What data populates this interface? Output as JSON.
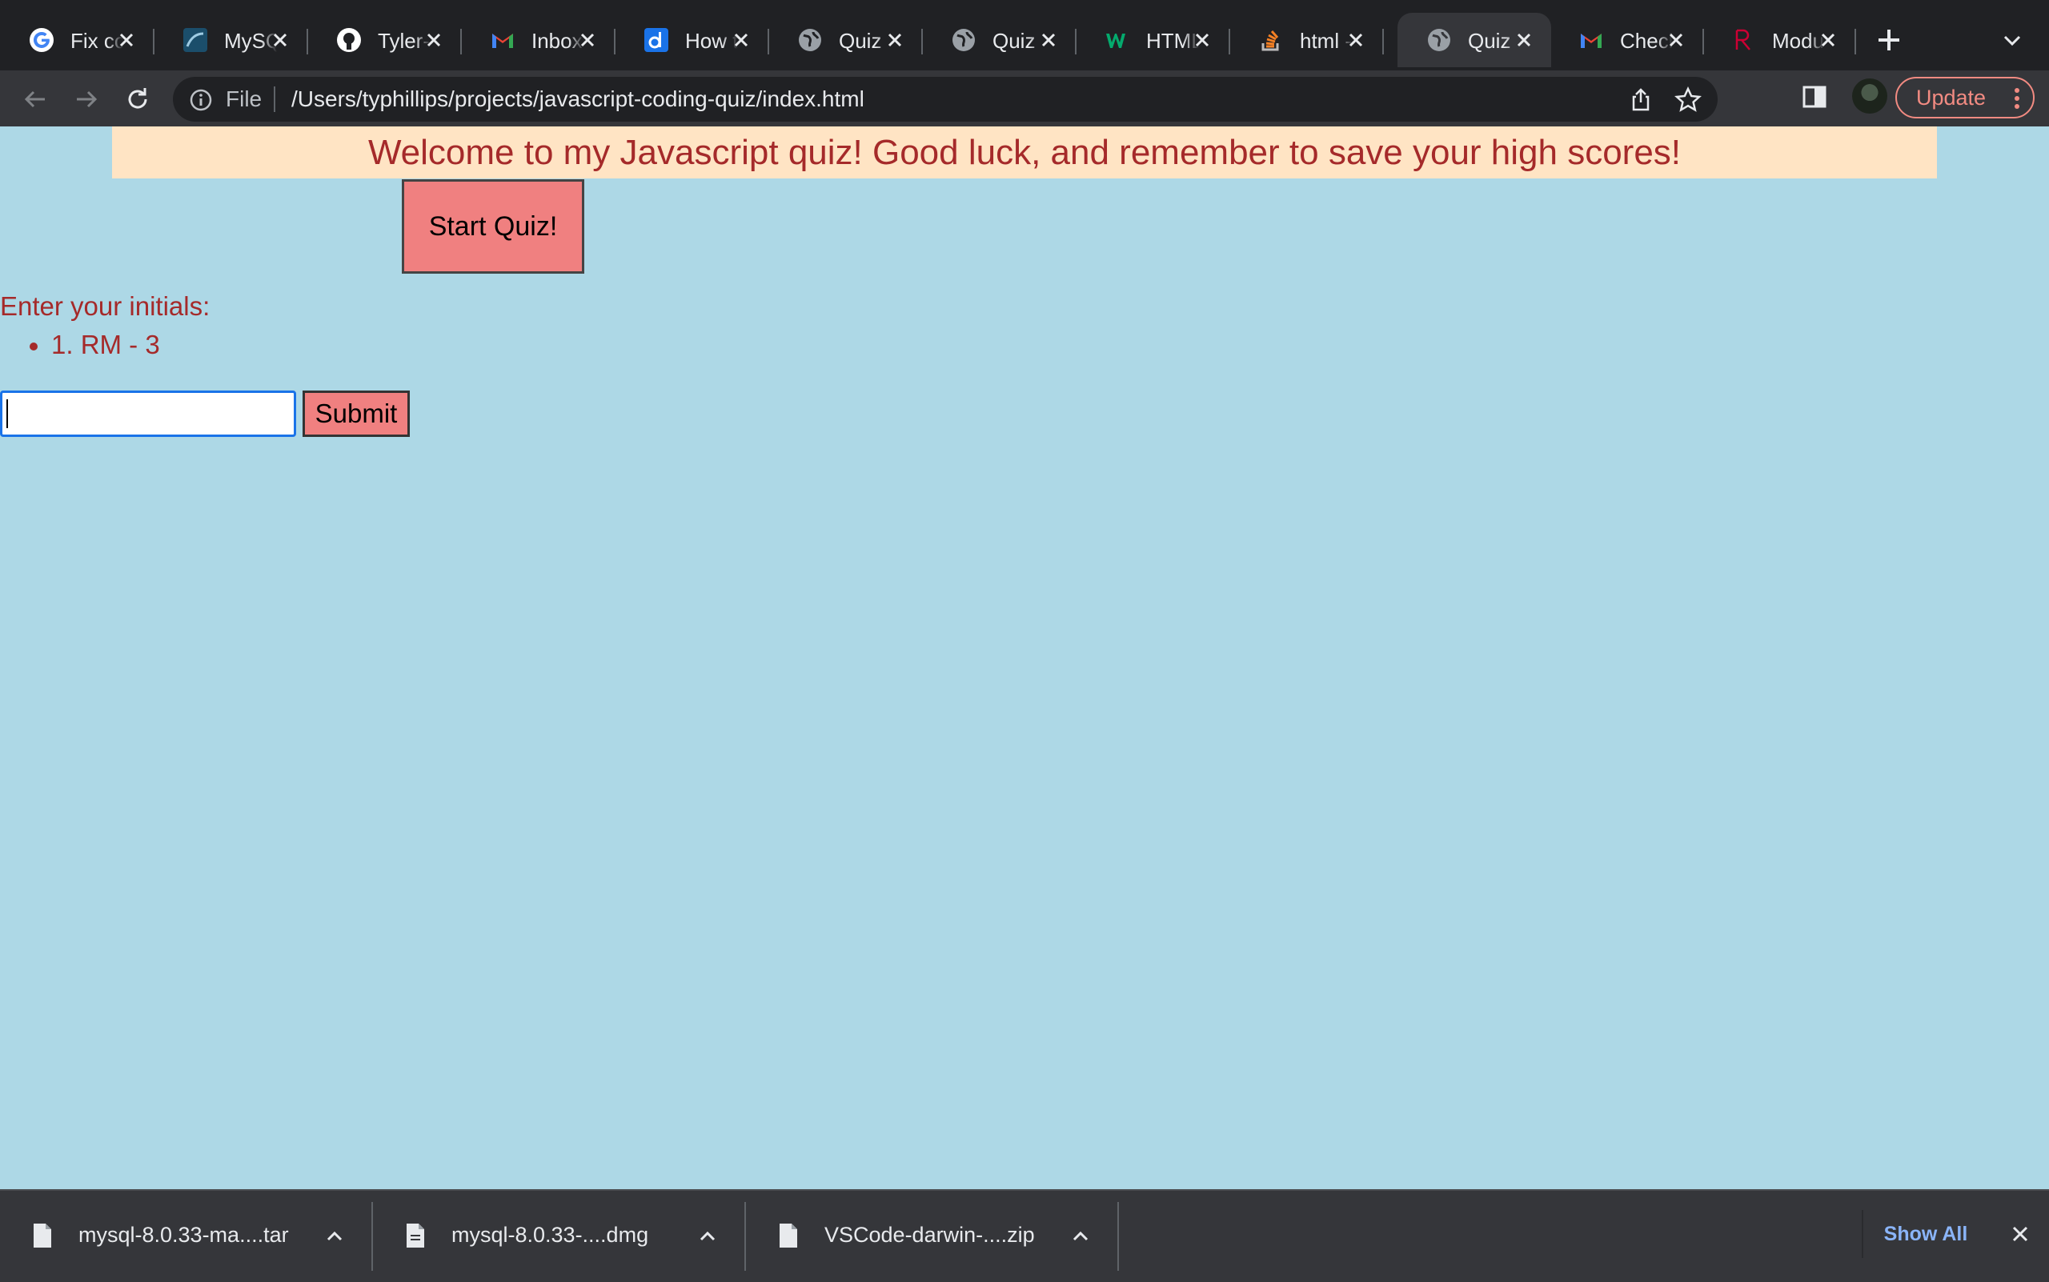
{
  "browser": {
    "tabs": [
      {
        "title": "Fix co",
        "icon": "google-icon",
        "active": false
      },
      {
        "title": "MySQ",
        "icon": "mysql-icon",
        "active": false
      },
      {
        "title": "Tyler-",
        "icon": "github-icon",
        "active": false
      },
      {
        "title": "Inbox",
        "icon": "gmail-icon",
        "active": false
      },
      {
        "title": "How t",
        "icon": "d-icon",
        "active": false
      },
      {
        "title": "Quiz",
        "icon": "globe-icon",
        "active": false
      },
      {
        "title": "Quiz",
        "icon": "globe-icon",
        "active": false
      },
      {
        "title": "HTML",
        "icon": "w3schools-icon",
        "active": false
      },
      {
        "title": "html -",
        "icon": "stackoverflow-icon",
        "active": false
      },
      {
        "title": "Quiz",
        "icon": "globe-icon",
        "active": true
      },
      {
        "title": "Checl",
        "icon": "gmail-icon",
        "active": false
      },
      {
        "title": "Modu",
        "icon": "r-icon",
        "active": false
      }
    ],
    "address": {
      "scheme_label": "File",
      "url": "/Users/typhillips/projects/javascript-coding-quiz/index.html"
    },
    "update_label": "Update"
  },
  "page": {
    "welcome": "Welcome to my Javascript quiz! Good luck, and remember to save your high scores!",
    "start_button": "Start Quiz!",
    "initials_prompt": "Enter your initials:",
    "high_scores": [
      "1. RM - 3"
    ],
    "initials_value": "",
    "submit_button": "Submit"
  },
  "downloads": {
    "items": [
      {
        "name": "mysql-8.0.33-ma....tar"
      },
      {
        "name": "mysql-8.0.33-....dmg"
      },
      {
        "name": "VSCode-darwin-....zip"
      }
    ],
    "show_all": "Show All"
  },
  "colors": {
    "page_background": "#add8e6",
    "banner_background": "#ffe4c4",
    "text_accent": "#a52a2a",
    "button_background": "#f08080",
    "browser_dark": "#202124",
    "update_accent": "#f28b82",
    "link_blue": "#8ab4f8"
  }
}
